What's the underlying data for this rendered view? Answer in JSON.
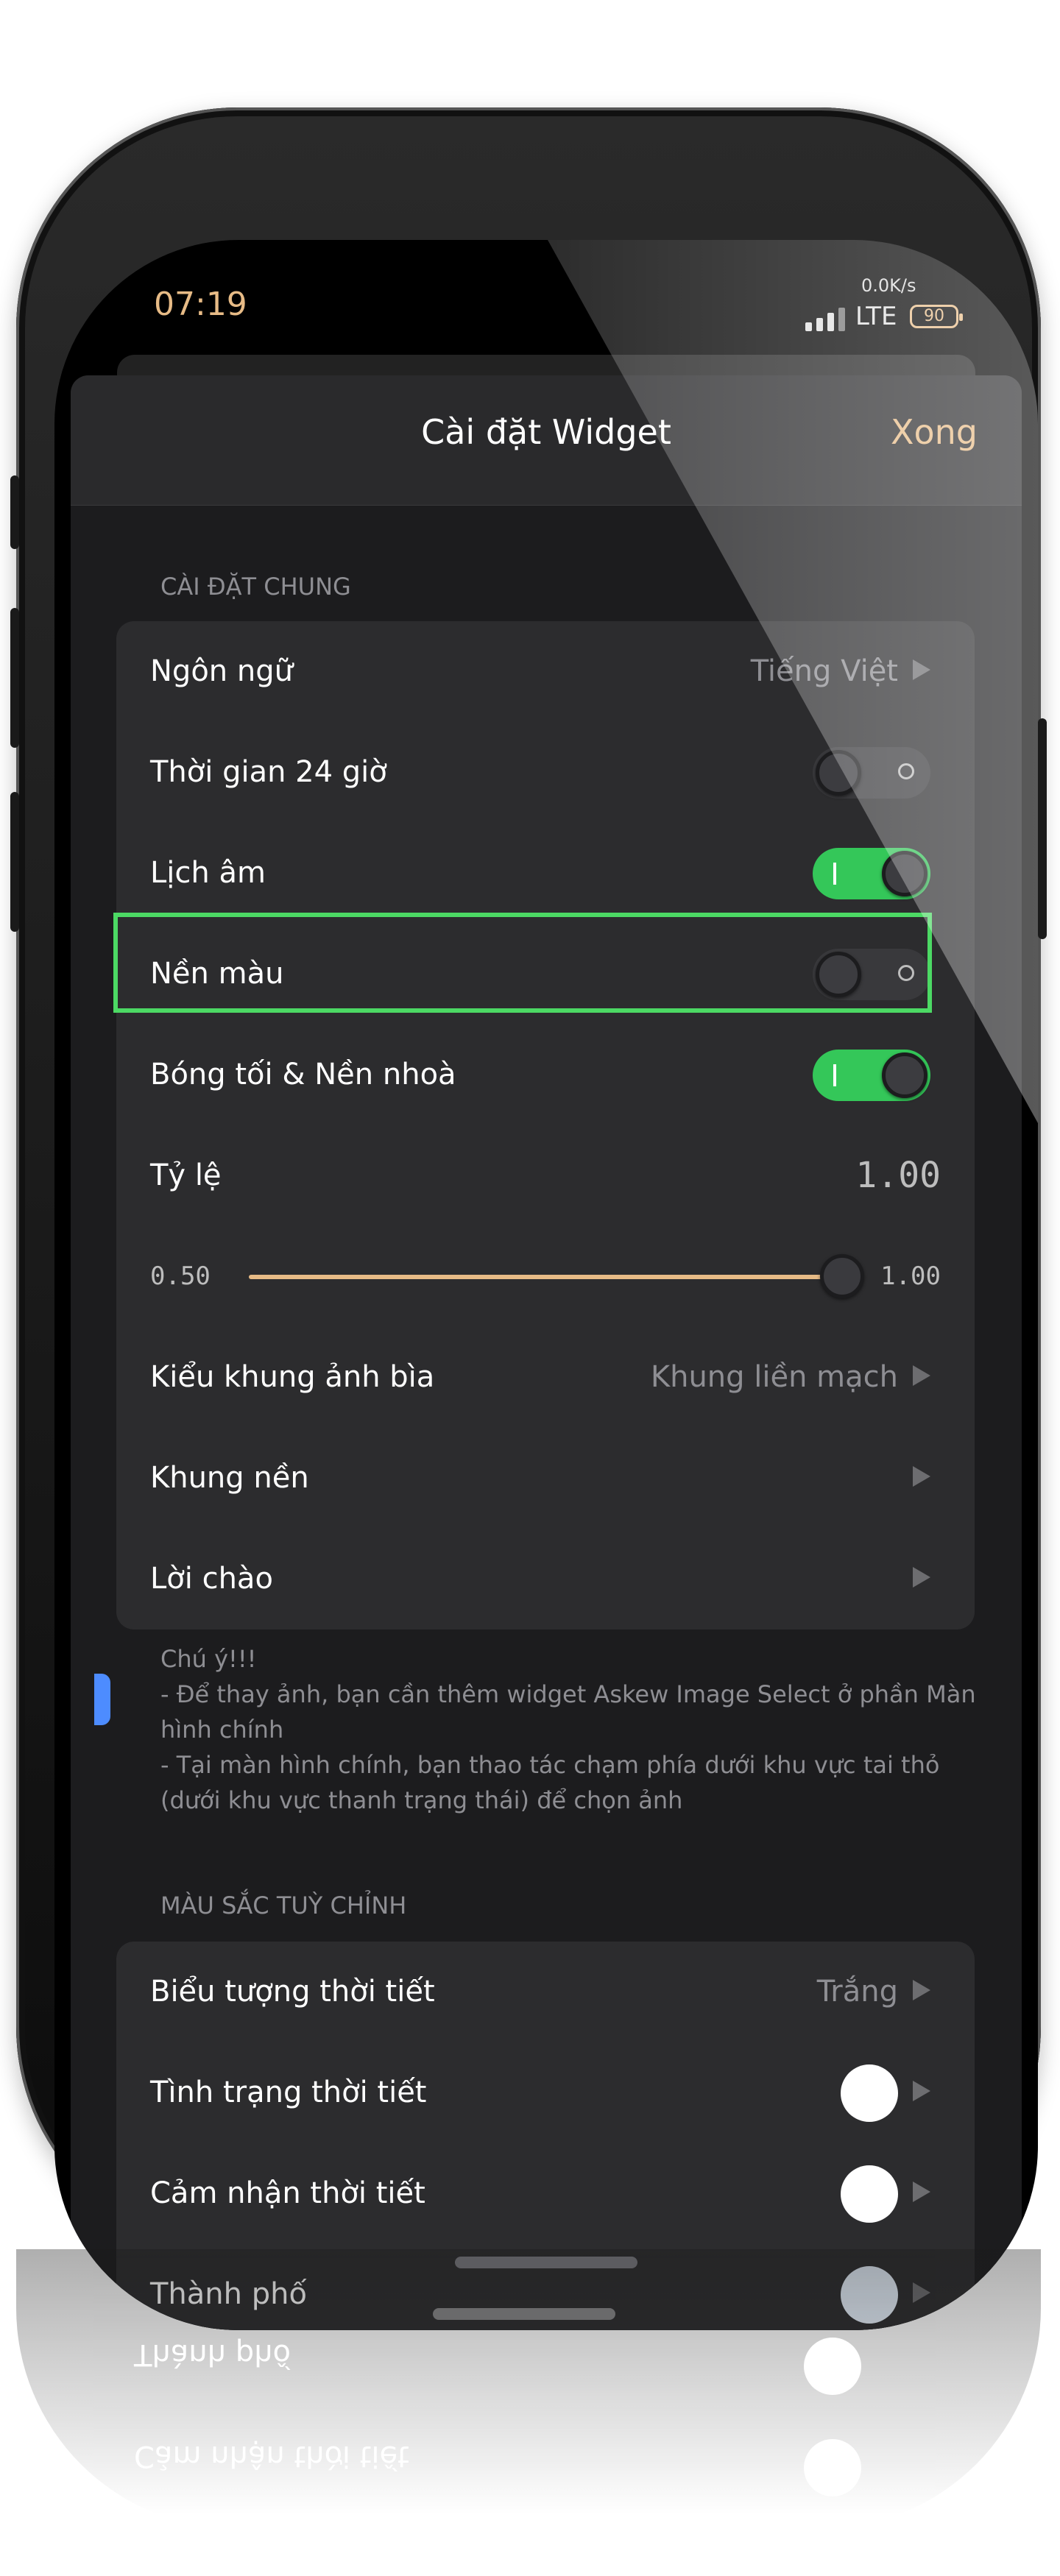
{
  "status_bar": {
    "time": "07:19",
    "net_speed": "0.0K/s",
    "network": "LTE",
    "battery": "90"
  },
  "nav": {
    "title": "Cài đặt Widget",
    "done": "Xong"
  },
  "general": {
    "header": "CÀI ĐẶT CHUNG",
    "language_label": "Ngôn ngữ",
    "language_value": "Tiếng Việt",
    "time24_label": "Thời gian 24 giờ",
    "time24_on": false,
    "lunar_label": "Lịch âm",
    "lunar_on": true,
    "bgcolor_label": "Nền màu",
    "bgcolor_on": false,
    "shadow_label": "Bóng tối & Nền nhoà",
    "shadow_on": true,
    "scale_label": "Tỷ lệ",
    "scale_value": "1.00",
    "slider_min": "0.50",
    "slider_max": "1.00",
    "slider_value": 1.0,
    "cover_label": "Kiểu khung ảnh bìa",
    "cover_value": "Khung liền mạch",
    "frame_label": "Khung nền",
    "greeting_label": "Lời chào"
  },
  "note": {
    "title": "Chú ý!!!",
    "line1": "- Để thay ảnh, bạn cần thêm widget Askew Image Select ở phần Màn hình chính",
    "line2": "- Tại màn hình chính, bạn thao tác chạm phía dưới khu vực tai thỏ (dưới khu vực thanh trạng thái) để chọn ảnh"
  },
  "custom_colors": {
    "header": "MÀU SẮC TUỲ CHỈNH",
    "weather_icon_label": "Biểu tượng thời tiết",
    "weather_icon_value": "Trắng",
    "weather_status_label": "Tình trạng thời tiết",
    "weather_feel_label": "Cảm nhận thời tiết",
    "city_label": "Thành phố",
    "swatch_color": "#ffffff"
  },
  "colors": {
    "accent": "#e7bb86",
    "toggle_on": "#34c759",
    "highlight": "#4cd964"
  }
}
